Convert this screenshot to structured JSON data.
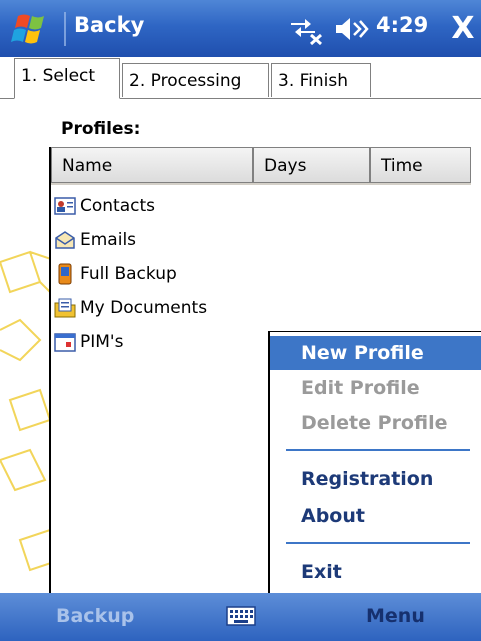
{
  "titlebar": {
    "app_title": "Backy",
    "time": "4:29",
    "close_label": "X",
    "icons": [
      "windows-start-icon",
      "network-icon",
      "volume-icon"
    ]
  },
  "tabs": [
    {
      "label": "1. Select",
      "active": true
    },
    {
      "label": "2. Processing",
      "active": false
    },
    {
      "label": "3. Finish",
      "active": false
    }
  ],
  "profiles": {
    "label": "Profiles:",
    "columns": [
      "Name",
      "Days",
      "Time"
    ],
    "items": [
      {
        "name": "Contacts",
        "icon": "contacts-icon"
      },
      {
        "name": "Emails",
        "icon": "email-icon"
      },
      {
        "name": "Full Backup",
        "icon": "phone-icon"
      },
      {
        "name": "My Documents",
        "icon": "documents-icon"
      },
      {
        "name": "PIM's",
        "icon": "calendar-icon"
      }
    ]
  },
  "context_menu": {
    "items": [
      {
        "label": "New Profile",
        "state": "selected"
      },
      {
        "label": "Edit Profile",
        "state": "disabled"
      },
      {
        "label": "Delete Profile",
        "state": "disabled"
      },
      {
        "label": "Registration",
        "state": "enabled"
      },
      {
        "label": "About",
        "state": "enabled"
      },
      {
        "label": "Exit",
        "state": "enabled"
      }
    ]
  },
  "softkeys": {
    "left": "Backup",
    "right": "Menu",
    "center_icon": "keyboard-icon"
  },
  "colors": {
    "accent": "#3d76c7",
    "titlebar": "#2f66c4",
    "disabled": "#9a9a9a",
    "menu_text": "#1d3a78"
  }
}
